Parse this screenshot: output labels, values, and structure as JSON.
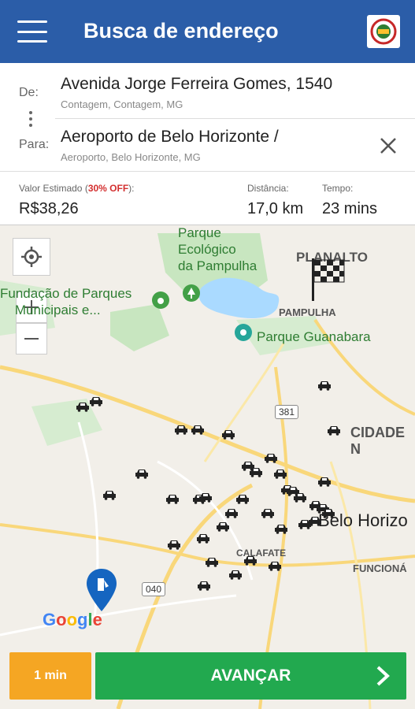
{
  "header": {
    "title": "Busca de endereço",
    "menu_icon": "menu-icon",
    "logo_icon": "app-logo-icon"
  },
  "route": {
    "from_label": "De:",
    "from_main": "Avenida Jorge Ferreira Gomes, 1540",
    "from_sub": "Contagem, Contagem, MG",
    "to_label": "Para:",
    "to_main": "Aeroporto de Belo Horizonte /",
    "to_sub": "Aeroporto, Belo Horizonte, MG",
    "clear_icon": "close-icon"
  },
  "estimate": {
    "value_label_prefix": "Valor Estimado (",
    "discount": "30% OFF",
    "value_label_suffix": "):",
    "value": "R$38,26",
    "distance_label": "Distância:",
    "distance": "17,0 km",
    "time_label": "Tempo:",
    "time": "23 mins"
  },
  "map": {
    "labels": {
      "parque_ecologico": "Parque\nEcológico\nda Pampulha",
      "planalto": "PLANALTO",
      "pampulha": "PAMPULHA",
      "fundacao": "Fundação de Parques\n    Municipais e...",
      "guanabara": "Parque Guanabara",
      "cidade": "CIDADE N",
      "belo": "Belo Horizo",
      "calafate": "CALAFATE",
      "funcionarios": "FUNCIONÁ",
      "road_381": "381",
      "road_040": "040",
      "google": "Google"
    },
    "colors": {
      "taxi": "#222222",
      "water": "#aadaff",
      "park": "#c8e6c0",
      "road": "#f9d77a",
      "pin": "#1565c0"
    }
  },
  "footer": {
    "time_button": "1 min",
    "go_button": "AVANÇAR",
    "chevron_icon": "chevron-right-icon"
  }
}
